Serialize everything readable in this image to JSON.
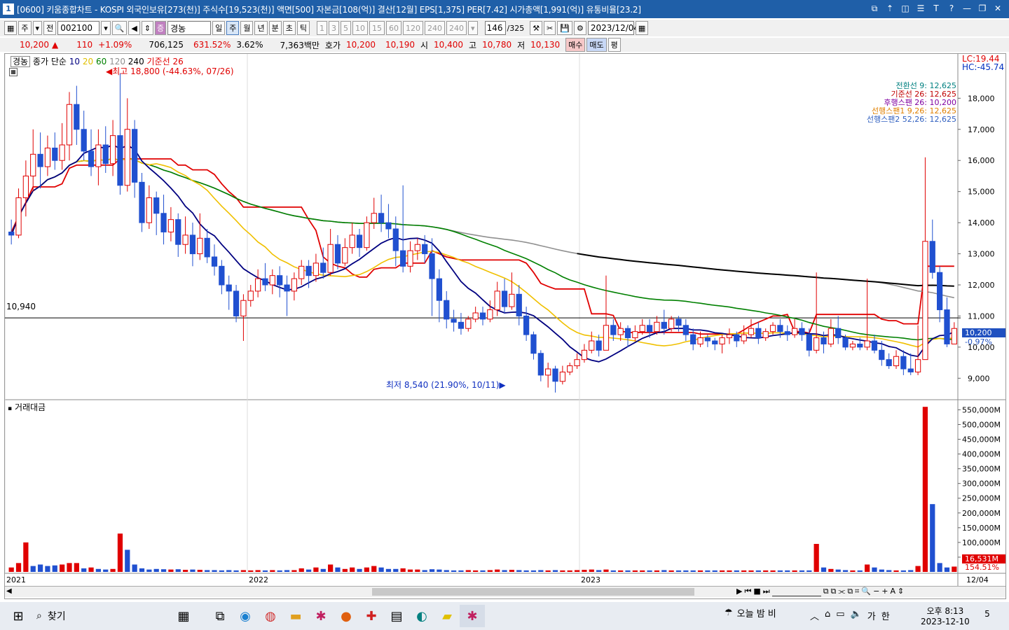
{
  "title_bar": {
    "window_number": "1",
    "title": "[0600] 키움종합차트 - KOSPI 외국인보유[273(천)] 주식수[19,523(천)] 액면[500] 자본금[108(억)] 결산[12월] EPS[1,375] PER[7.42] 시가총액[1,991(억)] 유통비율[23.2]",
    "controls": [
      "restore-icon",
      "up-icon",
      "split-icon",
      "list-icon",
      "text-icon",
      "help-icon",
      "minimize-icon",
      "maximize-icon",
      "close-icon"
    ]
  },
  "toolbar": {
    "period_label": "주",
    "jeon_label": "전",
    "code": "002100",
    "stock_name": "경농",
    "periods": [
      "일",
      "주",
      "월",
      "년",
      "분",
      "초",
      "틱"
    ],
    "selected_period": "주",
    "minute_options": [
      "1",
      "3",
      "5",
      "10",
      "15",
      "60",
      "120",
      "240",
      "240"
    ],
    "count": "146",
    "total": "/325",
    "date": "2023/12/04"
  },
  "quote": {
    "price": "10,200",
    "up_arrow": "▲",
    "change": "110",
    "change_pct": "+1.09%",
    "volume": "706,125",
    "volume_ratio": "631.52%",
    "turnover": "3.62%",
    "amount": "7,363백만",
    "hoga_label": "호가",
    "ask": "10,200",
    "bid": "10,190",
    "open_label": "시",
    "open": "10,400",
    "high_label": "고",
    "high": "10,780",
    "low_label": "저",
    "low": "10,130",
    "buy_label": "매수",
    "sell_label": "매도",
    "eval_label": "평"
  },
  "price_panel": {
    "name": "경농",
    "ma_label": "종가 단순",
    "ma_periods": [
      "10",
      "20",
      "60",
      "120",
      "240"
    ],
    "base_line": "기준선 26",
    "lc": "LC:19.44",
    "hc": "HC:-45.74",
    "high_note": "최고 18,800 (-44.63%, 07/26)",
    "low_note": "최저 8,540 (21.90%, 10/11)",
    "ref_line_label": "10,940",
    "ichimoku": [
      {
        "text": "전환선 9: 12,625",
        "color": "#008080"
      },
      {
        "text": "기준선 26: 12,625",
        "color": "#c00000"
      },
      {
        "text": "후행스팬 26: 10,200",
        "color": "#8000a0"
      },
      {
        "text": "선행스팬1 9,26: 12,625",
        "color": "#e08000"
      },
      {
        "text": "선행스팬2 52,26: 12,625",
        "color": "#3060c0"
      }
    ],
    "yticks": [
      "18,000",
      "17,000",
      "16,000",
      "15,000",
      "14,000",
      "13,000",
      "12,000",
      "11,000",
      "10,000",
      "9,000"
    ],
    "current_label": "10,200",
    "current_pct": "-0.97%"
  },
  "volume_panel": {
    "name": "거래대금",
    "yticks": [
      "550,000M",
      "500,000M",
      "450,000M",
      "400,000M",
      "350,000M",
      "300,000M",
      "250,000M",
      "200,000M",
      "150,000M",
      "100,000M",
      "50,000M"
    ],
    "current_label": "16,531M",
    "current_pct": "154.51%"
  },
  "x_labels": [
    "2021",
    "2022",
    "2023",
    "12/04"
  ],
  "chart_data": {
    "type": "candlestick",
    "price_range": [
      8400,
      19200
    ],
    "candles": [
      [
        13700,
        13600,
        14100,
        13300
      ],
      [
        13600,
        14800,
        15100,
        13500
      ],
      [
        14800,
        15500,
        16000,
        14200
      ],
      [
        15500,
        16200,
        17000,
        15000
      ],
      [
        16200,
        15800,
        16900,
        15100
      ],
      [
        15800,
        16400,
        16800,
        15500
      ],
      [
        16400,
        16000,
        16900,
        15700
      ],
      [
        16000,
        16500,
        17200,
        15700
      ],
      [
        16500,
        17800,
        18200,
        16000
      ],
      [
        17800,
        17000,
        18400,
        16500
      ],
      [
        17000,
        16300,
        17600,
        16000
      ],
      [
        16300,
        15800,
        17000,
        15500
      ],
      [
        15800,
        16500,
        17000,
        15200
      ],
      [
        16500,
        15900,
        17100,
        15600
      ],
      [
        15900,
        16800,
        17300,
        15500
      ],
      [
        16800,
        15200,
        18800,
        14900
      ],
      [
        15200,
        17000,
        18000,
        15000
      ],
      [
        17000,
        15300,
        17300,
        14800
      ],
      [
        15300,
        14000,
        15600,
        13700
      ],
      [
        14000,
        14800,
        15200,
        13800
      ],
      [
        14800,
        14300,
        15000,
        13600
      ],
      [
        14300,
        13700,
        14900,
        13300
      ],
      [
        13700,
        14100,
        14500,
        13400
      ],
      [
        14100,
        13300,
        14300,
        12900
      ],
      [
        13300,
        13600,
        14200,
        13000
      ],
      [
        13600,
        13000,
        14000,
        12600
      ],
      [
        13000,
        13500,
        14300,
        12800
      ],
      [
        13500,
        12900,
        13800,
        12700
      ],
      [
        12900,
        12600,
        13300,
        12300
      ],
      [
        12600,
        12000,
        12800,
        11700
      ],
      [
        12000,
        11800,
        12300,
        11200
      ],
      [
        11800,
        11000,
        12000,
        10800
      ],
      [
        11000,
        11500,
        11700,
        10200
      ],
      [
        11500,
        11800,
        12000,
        11300
      ],
      [
        11800,
        12200,
        12500,
        11600
      ],
      [
        12200,
        12000,
        12700,
        11800
      ],
      [
        12000,
        12300,
        12500,
        11700
      ],
      [
        12300,
        12000,
        12600,
        11600
      ],
      [
        12000,
        11800,
        12300,
        11000
      ],
      [
        11800,
        12200,
        12400,
        11500
      ],
      [
        12200,
        12600,
        12800,
        12000
      ],
      [
        12600,
        12300,
        12800,
        11900
      ],
      [
        12300,
        12700,
        13000,
        12100
      ],
      [
        12700,
        12400,
        13200,
        12200
      ],
      [
        12400,
        13300,
        13800,
        12300
      ],
      [
        13300,
        12700,
        13600,
        12500
      ],
      [
        12700,
        13200,
        13500,
        12600
      ],
      [
        13200,
        13600,
        14000,
        13000
      ],
      [
        13600,
        13200,
        13800,
        12900
      ],
      [
        13200,
        14000,
        14200,
        13100
      ],
      [
        14000,
        14300,
        14800,
        13800
      ],
      [
        14300,
        14000,
        14900,
        13700
      ],
      [
        14000,
        13800,
        14600,
        13500
      ],
      [
        13800,
        13100,
        14200,
        12600
      ],
      [
        13100,
        12600,
        15200,
        12400
      ],
      [
        12600,
        13100,
        13400,
        12400
      ],
      [
        13100,
        13300,
        13500,
        12800
      ],
      [
        13300,
        13000,
        13600,
        12700
      ],
      [
        13000,
        12200,
        13500,
        11000
      ],
      [
        12200,
        11500,
        12500,
        10800
      ],
      [
        11500,
        10900,
        11800,
        10600
      ],
      [
        10900,
        10800,
        11200,
        10500
      ],
      [
        10800,
        10600,
        11100,
        10400
      ],
      [
        10600,
        10900,
        11000,
        10500
      ],
      [
        10900,
        11100,
        11300,
        10800
      ],
      [
        11100,
        10900,
        11300,
        10700
      ],
      [
        10900,
        11200,
        11500,
        10800
      ],
      [
        11200,
        11800,
        12100,
        11000
      ],
      [
        11800,
        11300,
        12200,
        11100
      ],
      [
        11300,
        11700,
        12400,
        11200
      ],
      [
        11700,
        11000,
        12000,
        10700
      ],
      [
        11000,
        10400,
        11300,
        10200
      ],
      [
        10400,
        9800,
        10500,
        9600
      ],
      [
        9800,
        9100,
        9900,
        8900
      ],
      [
        9100,
        9300,
        9500,
        8700
      ],
      [
        9300,
        8900,
        9400,
        8540
      ],
      [
        8900,
        9200,
        9400,
        8800
      ],
      [
        9200,
        9400,
        9500,
        9100
      ],
      [
        9400,
        9600,
        9800,
        9300
      ],
      [
        9600,
        9900,
        10100,
        9500
      ],
      [
        9900,
        10200,
        10500,
        9800
      ],
      [
        10200,
        9900,
        10400,
        9700
      ],
      [
        9900,
        10700,
        12300,
        9900
      ],
      [
        10700,
        10400,
        10900,
        10200
      ],
      [
        10400,
        10600,
        10800,
        10200
      ],
      [
        10600,
        10300,
        10700,
        10000
      ],
      [
        10300,
        10500,
        10700,
        10200
      ],
      [
        10500,
        10700,
        10900,
        10400
      ],
      [
        10700,
        10500,
        10900,
        10300
      ],
      [
        10500,
        10800,
        11000,
        10400
      ],
      [
        10800,
        10600,
        11200,
        10400
      ],
      [
        10600,
        10900,
        11000,
        10500
      ],
      [
        10900,
        10700,
        11000,
        10500
      ],
      [
        10700,
        10400,
        10900,
        10200
      ],
      [
        10400,
        10100,
        10600,
        9900
      ],
      [
        10100,
        10300,
        10500,
        10000
      ],
      [
        10300,
        10200,
        10400,
        10000
      ],
      [
        10200,
        10100,
        10300,
        9900
      ],
      [
        10100,
        10300,
        10400,
        9800
      ],
      [
        10300,
        10400,
        10600,
        10100
      ],
      [
        10400,
        10200,
        10500,
        10000
      ],
      [
        10200,
        10400,
        10700,
        10100
      ],
      [
        10400,
        10600,
        10900,
        10300
      ],
      [
        10600,
        10300,
        10800,
        10100
      ],
      [
        10300,
        10500,
        10600,
        10200
      ],
      [
        10500,
        10700,
        10800,
        10400
      ],
      [
        10700,
        10500,
        10900,
        10300
      ],
      [
        10500,
        10400,
        10700,
        10200
      ],
      [
        10400,
        10600,
        10900,
        10300
      ],
      [
        10600,
        10400,
        10800,
        10200
      ],
      [
        10400,
        9900,
        10600,
        9700
      ],
      [
        9900,
        10300,
        12400,
        9800
      ],
      [
        10300,
        10100,
        10500,
        9800
      ],
      [
        10100,
        10600,
        10900,
        10000
      ],
      [
        10600,
        10300,
        11000,
        10100
      ],
      [
        10300,
        10000,
        10400,
        9900
      ],
      [
        10000,
        10100,
        10200,
        9900
      ],
      [
        10100,
        10000,
        10300,
        9900
      ],
      [
        10000,
        10200,
        12200,
        9900
      ],
      [
        10200,
        9900,
        10400,
        9800
      ],
      [
        9900,
        9600,
        10200,
        9400
      ],
      [
        9600,
        9400,
        9800,
        9300
      ],
      [
        9400,
        9700,
        9900,
        9300
      ],
      [
        9700,
        9300,
        9900,
        9100
      ],
      [
        9300,
        9200,
        9800,
        9100
      ],
      [
        9200,
        9600,
        10700,
        9100
      ],
      [
        9600,
        13400,
        16100,
        9600
      ],
      [
        13400,
        12400,
        14100,
        12200
      ],
      [
        12400,
        11200,
        12600,
        10800
      ],
      [
        11200,
        10100,
        11600,
        10000
      ],
      [
        10100,
        10600,
        10800,
        10100
      ]
    ],
    "volume_range": [
      0,
      570000
    ],
    "volumes": [
      [
        15000,
        1
      ],
      [
        30000,
        1
      ],
      [
        100000,
        1
      ],
      [
        20000,
        0
      ],
      [
        25000,
        0
      ],
      [
        20000,
        0
      ],
      [
        22000,
        0
      ],
      [
        25000,
        1
      ],
      [
        30000,
        1
      ],
      [
        30000,
        1
      ],
      [
        12000,
        0
      ],
      [
        15000,
        1
      ],
      [
        10000,
        0
      ],
      [
        8000,
        0
      ],
      [
        10000,
        1
      ],
      [
        130000,
        1
      ],
      [
        75000,
        0
      ],
      [
        25000,
        0
      ],
      [
        12000,
        0
      ],
      [
        8000,
        0
      ],
      [
        10000,
        0
      ],
      [
        9000,
        0
      ],
      [
        8000,
        1
      ],
      [
        9000,
        0
      ],
      [
        7000,
        1
      ],
      [
        8000,
        0
      ],
      [
        7000,
        1
      ],
      [
        6000,
        0
      ],
      [
        6000,
        0
      ],
      [
        5000,
        0
      ],
      [
        6000,
        0
      ],
      [
        5000,
        0
      ],
      [
        6000,
        1
      ],
      [
        5000,
        1
      ],
      [
        6000,
        1
      ],
      [
        5000,
        0
      ],
      [
        6000,
        1
      ],
      [
        5000,
        0
      ],
      [
        6000,
        0
      ],
      [
        6000,
        1
      ],
      [
        12000,
        1
      ],
      [
        8000,
        0
      ],
      [
        15000,
        1
      ],
      [
        10000,
        0
      ],
      [
        25000,
        1
      ],
      [
        15000,
        0
      ],
      [
        10000,
        1
      ],
      [
        15000,
        1
      ],
      [
        10000,
        0
      ],
      [
        15000,
        1
      ],
      [
        20000,
        1
      ],
      [
        15000,
        0
      ],
      [
        10000,
        0
      ],
      [
        10000,
        0
      ],
      [
        12000,
        1
      ],
      [
        8000,
        1
      ],
      [
        8000,
        1
      ],
      [
        6000,
        0
      ],
      [
        9000,
        0
      ],
      [
        8000,
        0
      ],
      [
        6000,
        0
      ],
      [
        5000,
        0
      ],
      [
        5000,
        0
      ],
      [
        6000,
        1
      ],
      [
        5000,
        1
      ],
      [
        5000,
        0
      ],
      [
        6000,
        1
      ],
      [
        8000,
        1
      ],
      [
        6000,
        0
      ],
      [
        7000,
        1
      ],
      [
        6000,
        0
      ],
      [
        5000,
        0
      ],
      [
        5000,
        0
      ],
      [
        6000,
        0
      ],
      [
        5000,
        1
      ],
      [
        6000,
        0
      ],
      [
        5000,
        1
      ],
      [
        5000,
        1
      ],
      [
        6000,
        1
      ],
      [
        7000,
        1
      ],
      [
        8000,
        1
      ],
      [
        6000,
        0
      ],
      [
        8000,
        1
      ],
      [
        5000,
        0
      ],
      [
        5000,
        1
      ],
      [
        5000,
        0
      ],
      [
        5000,
        1
      ],
      [
        5000,
        1
      ],
      [
        5000,
        0
      ],
      [
        5000,
        1
      ],
      [
        6000,
        0
      ],
      [
        5000,
        1
      ],
      [
        5000,
        0
      ],
      [
        5000,
        0
      ],
      [
        5000,
        0
      ],
      [
        5000,
        1
      ],
      [
        5000,
        0
      ],
      [
        5000,
        0
      ],
      [
        5000,
        1
      ],
      [
        5000,
        1
      ],
      [
        5000,
        0
      ],
      [
        5000,
        1
      ],
      [
        5000,
        1
      ],
      [
        5000,
        0
      ],
      [
        5000,
        1
      ],
      [
        5000,
        1
      ],
      [
        5000,
        0
      ],
      [
        5000,
        0
      ],
      [
        5000,
        1
      ],
      [
        5000,
        0
      ],
      [
        5000,
        0
      ],
      [
        95000,
        1
      ],
      [
        15000,
        0
      ],
      [
        10000,
        1
      ],
      [
        8000,
        0
      ],
      [
        6000,
        0
      ],
      [
        5000,
        1
      ],
      [
        5000,
        0
      ],
      [
        25000,
        1
      ],
      [
        15000,
        0
      ],
      [
        8000,
        0
      ],
      [
        6000,
        0
      ],
      [
        5000,
        1
      ],
      [
        5000,
        0
      ],
      [
        6000,
        0
      ],
      [
        20000,
        1
      ],
      [
        560000,
        1
      ],
      [
        230000,
        0
      ],
      [
        30000,
        0
      ],
      [
        15000,
        0
      ],
      [
        18000,
        1
      ]
    ]
  },
  "taskbar": {
    "search_label": "찾기",
    "weather": "오늘 밤 비",
    "ime": "가",
    "lang": "한",
    "time": "오후 8:13",
    "date": "2023-12-10",
    "notif_count": "5"
  }
}
